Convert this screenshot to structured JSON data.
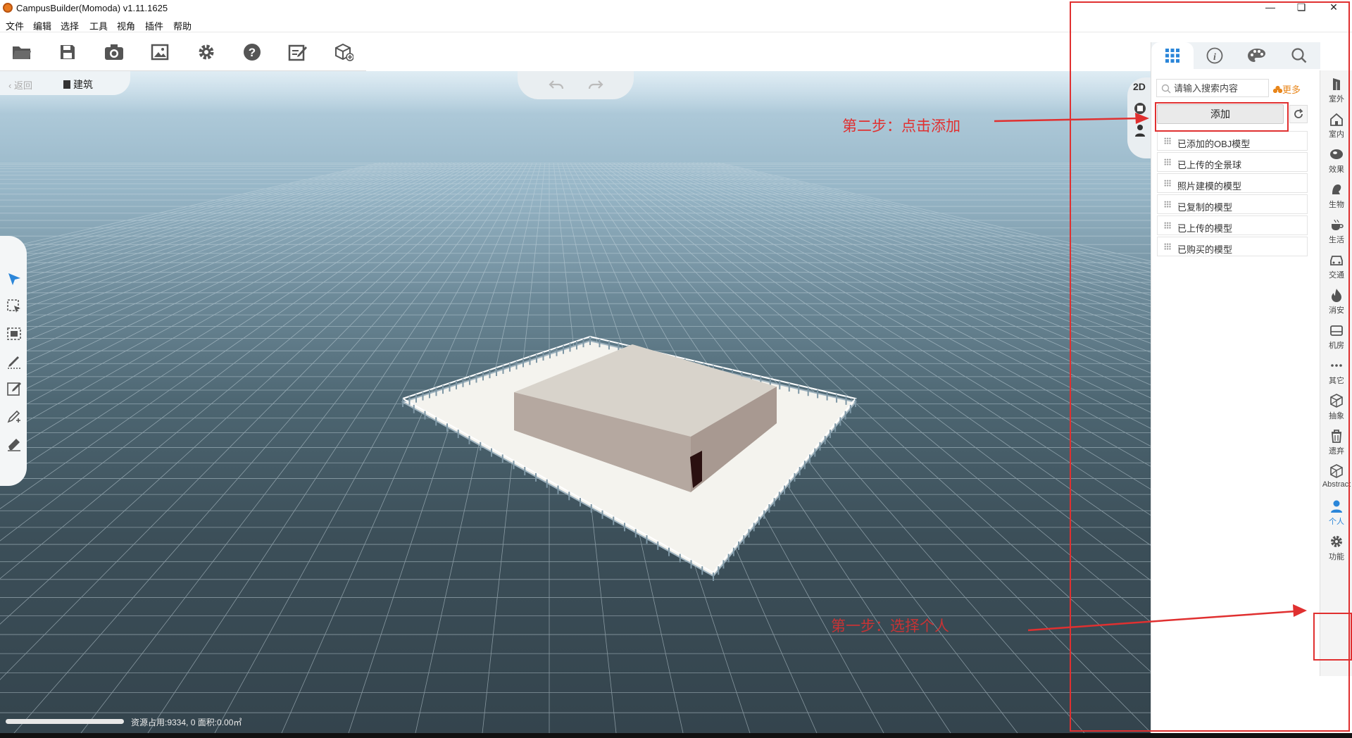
{
  "window": {
    "title": "CampusBuilder(Momoda) v1.11.1625"
  },
  "menu": {
    "items": [
      "文件",
      "编辑",
      "选择",
      "工具",
      "视角",
      "插件",
      "帮助"
    ]
  },
  "breadcrumb": {
    "back": "返回",
    "current": "建筑"
  },
  "view_toggle": {
    "label": "2D"
  },
  "status": {
    "text": "资源占用:9334, 0   面积:0.00㎡"
  },
  "panel": {
    "search_placeholder": "请输入搜索内容",
    "more": "更多",
    "add_button": "添加",
    "categories": [
      "已添加的OBJ模型",
      "已上传的全景球",
      "照片建模的模型",
      "已复制的模型",
      "已上传的模型",
      "已购买的模型"
    ]
  },
  "rail": {
    "items": [
      "室外",
      "室内",
      "效果",
      "生物",
      "生活",
      "交通",
      "消安",
      "机房",
      "其它",
      "抽象",
      "遗弃",
      "Abstract",
      "个人",
      "功能"
    ],
    "icons": [
      "building-icon",
      "house-icon",
      "effect-icon",
      "creature-icon",
      "cup-icon",
      "car-icon",
      "fire-icon",
      "server-icon",
      "more-icon",
      "cube-icon",
      "trash-icon",
      "abstract-cube-icon",
      "person-icon",
      "gear-icon"
    ],
    "active": "个人"
  },
  "annotations": {
    "step2": "第二步：点击添加",
    "step1": "第一步：选择个人"
  },
  "colors": {
    "annotation": "#e03030",
    "accent": "#2b86d9",
    "more": "#e8861b"
  }
}
